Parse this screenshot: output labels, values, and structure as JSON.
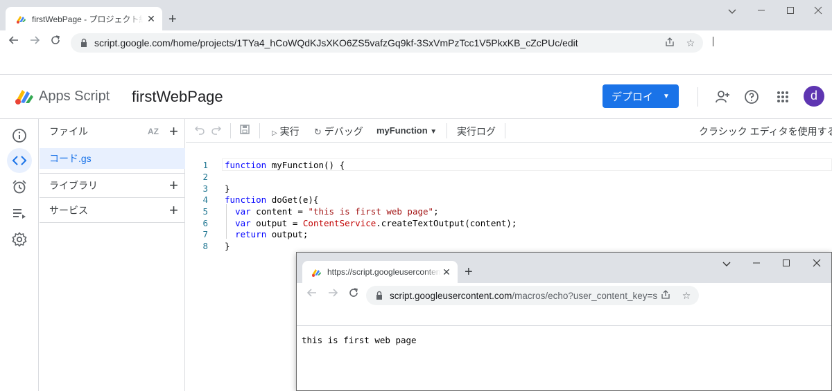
{
  "browser": {
    "tab_title": "firstWebPage - プロジェクト編集者 - Apps Script",
    "url": "script.google.com/home/projects/1TYa4_hCoWQdKJsXKO6ZS5vafzGq9kf-3SxVmPzTcc1V5PkxKB_cZcPUc/edit",
    "new_tab_label": "+"
  },
  "header": {
    "app_name": "Apps Script",
    "project_name": "firstWebPage",
    "deploy_label": "デプロイ"
  },
  "files_panel": {
    "title": "ファイル",
    "sort_label": "AZ",
    "file": "コード.gs",
    "libraries": "ライブラリ",
    "services": "サービス"
  },
  "editor_toolbar": {
    "run": "実行",
    "debug": "デバッグ",
    "function_select": "myFunction",
    "exec_log": "実行ログ",
    "classic": "クラシック エディタを使用する"
  },
  "code": {
    "line_numbers": [
      "1",
      "2",
      "3",
      "4",
      "5",
      "6",
      "7",
      "8"
    ]
  },
  "popup": {
    "tab_title": "https://script.googleusercontent.com/macros/echo",
    "url_host": "script.googleusercontent.com",
    "url_path": "/macros/echo?user_content_key=s...",
    "body_text": "this is first web page"
  }
}
